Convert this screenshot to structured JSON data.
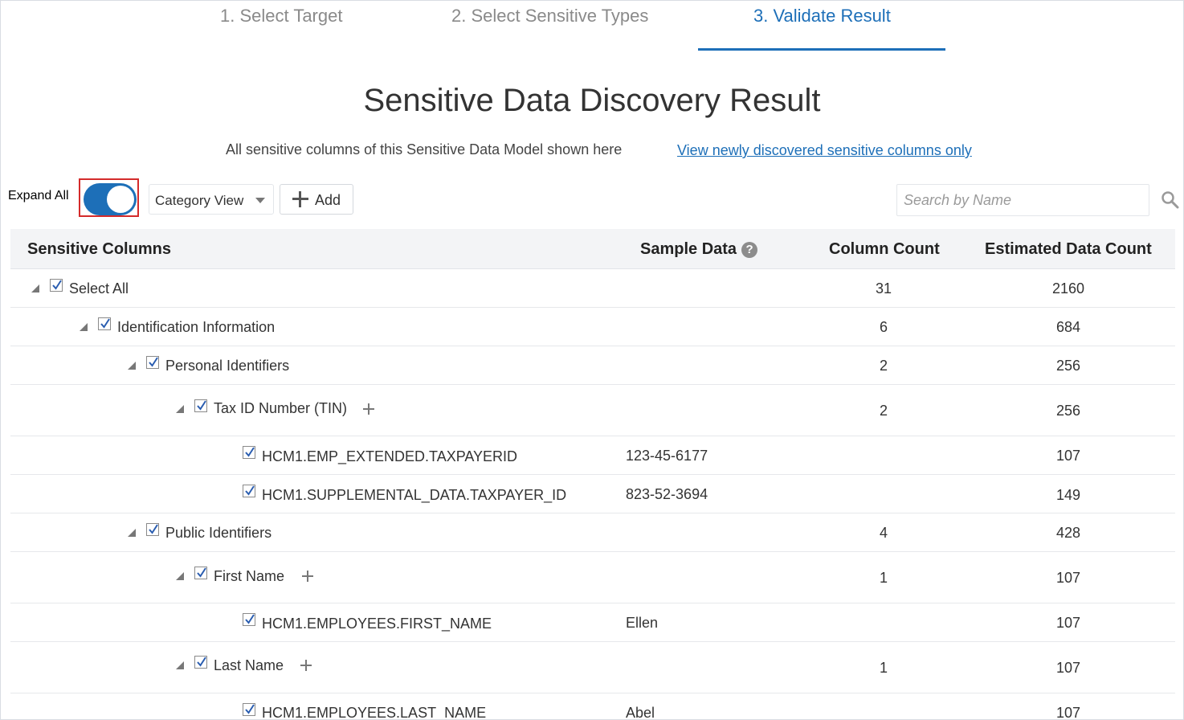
{
  "steps": [
    {
      "label": "1. Select Target",
      "active": false
    },
    {
      "label": "2. Select Sensitive Types",
      "active": false
    },
    {
      "label": "3. Validate Result",
      "active": true
    }
  ],
  "page": {
    "title": "Sensitive Data Discovery Result",
    "subtitle": "All sensitive columns of this Sensitive Data Model shown here",
    "subtitle_link": "View newly discovered sensitive columns only"
  },
  "toolbar": {
    "expand_all_label": "Expand All",
    "expand_all_on": true,
    "view_select_value": "Category View",
    "add_label": "Add",
    "search_placeholder": "Search by Name"
  },
  "table": {
    "columns": [
      "Sensitive Columns",
      "Sample Data",
      "Column Count",
      "Estimated Data Count"
    ],
    "help_glyph": "?",
    "rows": [
      {
        "label": "Select All",
        "sample": "",
        "column_count": "31",
        "estimated": "2160"
      },
      {
        "label": "Identification Information",
        "sample": "",
        "column_count": "6",
        "estimated": "684"
      },
      {
        "label": "Personal Identifiers",
        "sample": "",
        "column_count": "2",
        "estimated": "256"
      },
      {
        "label": "Tax ID Number (TIN)",
        "sample": "",
        "column_count": "2",
        "estimated": "256"
      },
      {
        "label": "HCM1.EMP_EXTENDED.TAXPAYERID",
        "sample": "123-45-6177",
        "column_count": "",
        "estimated": "107"
      },
      {
        "label": "HCM1.SUPPLEMENTAL_DATA.TAXPAYER_ID",
        "sample": "823-52-3694",
        "column_count": "",
        "estimated": "149"
      },
      {
        "label": "Public Identifiers",
        "sample": "",
        "column_count": "4",
        "estimated": "428"
      },
      {
        "label": "First Name",
        "sample": "",
        "column_count": "1",
        "estimated": "107"
      },
      {
        "label": "HCM1.EMPLOYEES.FIRST_NAME",
        "sample": "Ellen",
        "column_count": "",
        "estimated": "107"
      },
      {
        "label": "Last Name",
        "sample": "",
        "column_count": "1",
        "estimated": "107"
      },
      {
        "label": "HCM1.EMPLOYEES.LAST_NAME",
        "sample": "Abel",
        "column_count": "",
        "estimated": "107"
      }
    ]
  },
  "colors": {
    "accent": "#1d6fb8",
    "highlight_border": "#d42b2b"
  }
}
